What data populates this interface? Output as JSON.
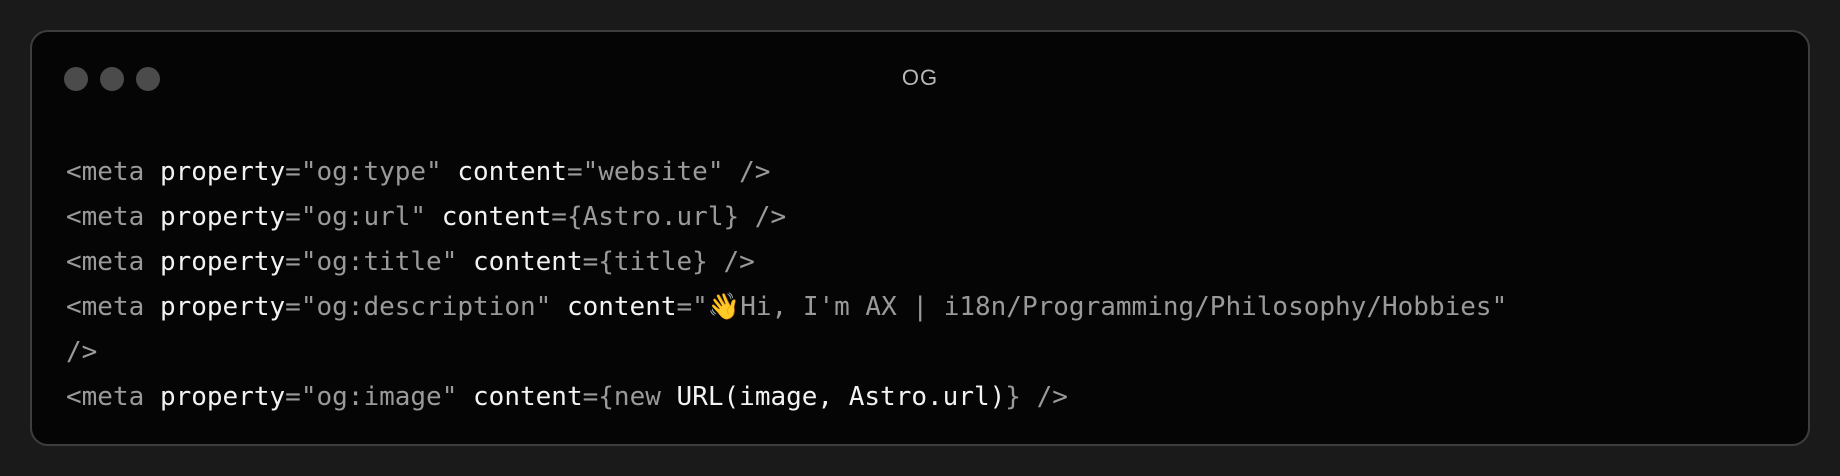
{
  "window": {
    "title": "OG"
  },
  "code": {
    "lines": [
      {
        "open": "<meta",
        "attr1": "property",
        "eq1": "=",
        "val1": "\"og:type\"",
        "attr2": "content",
        "eq2": "=",
        "val2": "\"website\"",
        "close": " />"
      },
      {
        "open": "<meta",
        "attr1": "property",
        "eq1": "=",
        "val1": "\"og:url\"",
        "attr2": "content",
        "eq2": "=",
        "val2": "{Astro.url}",
        "close": " />"
      },
      {
        "open": "<meta",
        "attr1": "property",
        "eq1": "=",
        "val1": "\"og:title\"",
        "attr2": "content",
        "eq2": "=",
        "val2": "{title}",
        "close": " />"
      },
      {
        "open": "<meta",
        "attr1": "property",
        "eq1": "=",
        "val1": "\"og:description\"",
        "attr2": "content",
        "eq2": "=",
        "val2_quote": "\"",
        "val2_emoji": "👋",
        "val2_rest": "Hi, I'm AX | i18n/Programming/Philosophy/Hobbies\"",
        "close": "/>"
      },
      {
        "open": "<meta",
        "attr1": "property",
        "eq1": "=",
        "val1": "\"og:image\"",
        "attr2": "content",
        "eq2": "=",
        "val2_open": "{",
        "val2_kw": "new",
        "val2_ident": "URL(image,",
        "val2_ident2": "Astro.url)",
        "val2_close": "}",
        "close": " />"
      }
    ]
  },
  "colors": {
    "window_bg": "#050505",
    "border": "#3e3e3e",
    "dot": "#4b4b4b",
    "attr": "#f2f2f2",
    "dim": "#9a9a9a"
  }
}
